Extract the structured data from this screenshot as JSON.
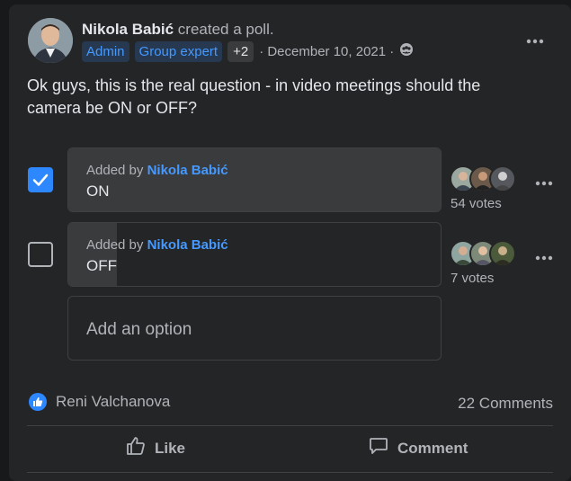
{
  "post": {
    "author": "Nikola Babić",
    "action": "created a poll.",
    "badges": [
      "Admin",
      "Group expert"
    ],
    "extra_badges": "+2",
    "date": "· December 10, 2021 ·",
    "privacy_icon": "group-icon",
    "more_icon": "more-icon",
    "text": "Ok guys, this is the real question - in video meetings should the camera be ON or OFF?"
  },
  "poll": {
    "options": [
      {
        "added_by_prefix": "Added by",
        "added_by": "Nikola Babić",
        "label": "ON",
        "votes": "54 votes",
        "vote_count": 54,
        "checked": true
      },
      {
        "added_by_prefix": "Added by",
        "added_by": "Nikola Babić",
        "label": "OFF",
        "votes": "7 votes",
        "vote_count": 7,
        "checked": false
      }
    ],
    "add_option_placeholder": "Add an option"
  },
  "footer": {
    "reaction_icon": "like-icon",
    "reactors": "Reni Valchanova",
    "comments": "22 Comments",
    "like_label": "Like",
    "comment_label": "Comment"
  },
  "colors": {
    "accent": "#2d88ff",
    "card_bg": "#242526",
    "page_bg": "#18191a",
    "badge_bg": "#263951",
    "badge_text": "#4599ff"
  }
}
